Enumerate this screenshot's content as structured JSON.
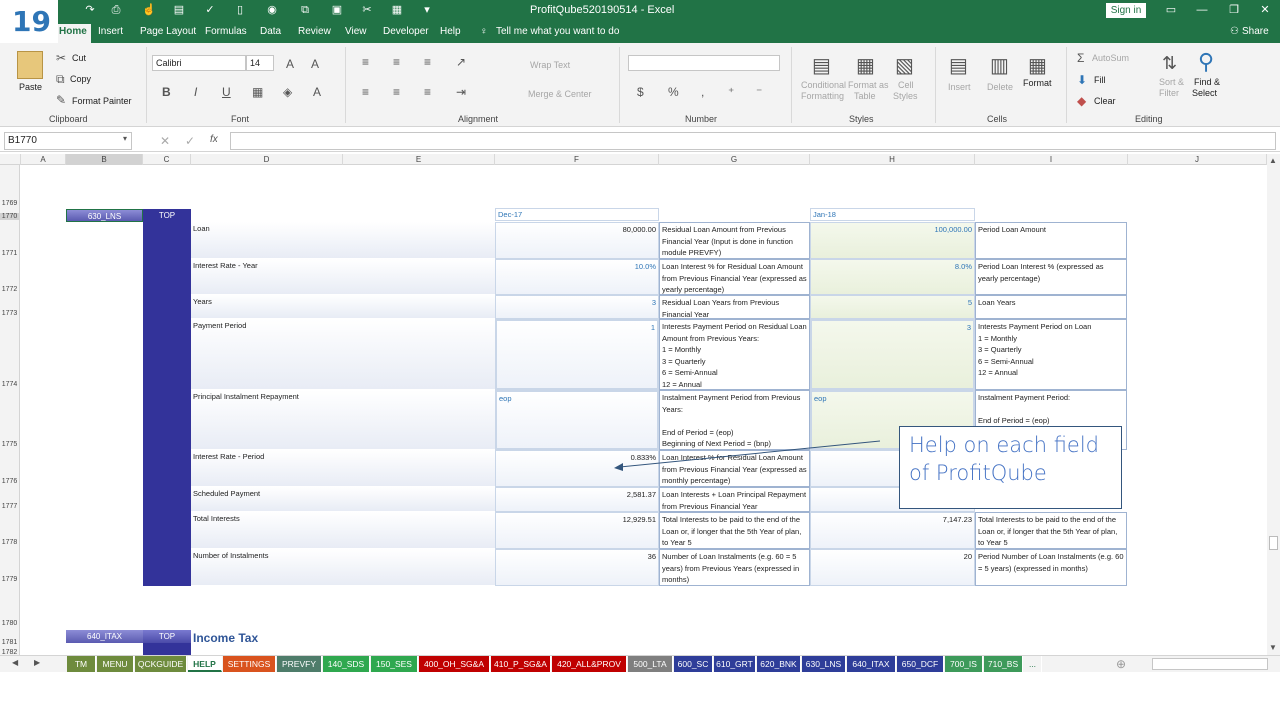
{
  "slide_number": "19",
  "window": {
    "title": "ProfitQube520190514  -  Excel",
    "sign_in": "Sign in",
    "share": "Share"
  },
  "tabs": [
    {
      "label": "Home",
      "active": true
    },
    {
      "label": "Insert"
    },
    {
      "label": "Page Layout"
    },
    {
      "label": "Formulas"
    },
    {
      "label": "Data"
    },
    {
      "label": "Review"
    },
    {
      "label": "View"
    },
    {
      "label": "Developer"
    },
    {
      "label": "Help"
    },
    {
      "label": "Tell me what you want to do"
    }
  ],
  "ribbon": {
    "paste": "Paste",
    "cut": "Cut",
    "copy": "Copy",
    "format_painter": "Format Painter",
    "clipboard": "Clipboard",
    "font_name": "Calibri",
    "font_size": "14",
    "font": "Font",
    "wrap_text": "Wrap Text",
    "merge_center": "Merge & Center",
    "alignment": "Alignment",
    "number": "Number",
    "conditional_formatting_1": "Conditional",
    "conditional_formatting_2": "Formatting",
    "format_as_table_1": "Format as",
    "format_as_table_2": "Table",
    "cell_styles_1": "Cell",
    "cell_styles_2": "Styles",
    "styles": "Styles",
    "insert": "Insert",
    "delete": "Delete",
    "format": "Format",
    "cells": "Cells",
    "autosum": "AutoSum",
    "fill": "Fill",
    "clear": "Clear",
    "sort_filter_1": "Sort &",
    "sort_filter_2": "Filter",
    "find_select_1": "Find &",
    "find_select_2": "Select",
    "editing": "Editing"
  },
  "formula_bar": {
    "name_box": "B1770",
    "formula": ""
  },
  "columns": [
    "A",
    "B",
    "C",
    "D",
    "E",
    "F",
    "G",
    "H",
    "I",
    "J"
  ],
  "rows": [
    "1769",
    "1770",
    "1771",
    "1772",
    "1773",
    "1774",
    "1775",
    "1776",
    "1777",
    "1778",
    "1779",
    "1780",
    "1781",
    "1782"
  ],
  "sheet": {
    "btn_lns": "630_LNS",
    "btn_top": "TOP",
    "btn_itax": "640_ITAX",
    "btn_top2": "TOP",
    "income_tax": "Income Tax",
    "period1": "Dec-17",
    "period2": "Jan-18",
    "items": [
      {
        "label": "Loan",
        "v1": "80,000.00",
        "d1": "Residual Loan Amount from Previous Financial Year (Input is done in function module PREVFY)",
        "v2": "100,000.00",
        "d2": "Period Loan Amount"
      },
      {
        "label": "Interest Rate - Year",
        "v1": "10.0%",
        "d1": "Loan Interest % for Residual Loan Amount from Previous Financial Year (expressed as yearly percentage)",
        "v2": "8.0%",
        "d2": "Period Loan Interest % (expressed as yearly percentage)"
      },
      {
        "label": "Years",
        "v1": "3",
        "d1": "Residual Loan Years  from Previous Financial Year",
        "v2": "5",
        "d2": "Loan Years"
      },
      {
        "label": "Payment Period",
        "v1": "1",
        "d1": "Interests Payment Period on Residual Loan Amount from Previous Years:\n1 = Monthly\n3 = Quarterly\n6 = Semi-Annual\n12 = Annual",
        "v2": "3",
        "d2": "Interests Payment Period on Loan\n1 = Monthly\n3 = Quarterly\n6 = Semi-Annual\n12 = Annual"
      },
      {
        "label": "Principal Instalment Repayment",
        "v1": "eop",
        "d1": "Instalment Payment Period from Previous Years:\n\nEnd of Period  = (eop)\nBeginning of Next Period  = (bnp)",
        "v2": "eop",
        "d2": "Instalment Payment Period:\n\nEnd of Period = (eop)"
      },
      {
        "label": "Interest Rate - Period",
        "v1": "0.833%",
        "d1": "Loan Interest % for Residual Loan Amount from Previous Financial Year (expressed as monthly percentage)",
        "v2": "",
        "d2": ""
      },
      {
        "label": "Scheduled Payment",
        "v1": "2,581.37",
        "d1": "Loan Interests + Loan Principal Repayment from Previous Financial Year",
        "v2": "",
        "d2": ""
      },
      {
        "label": "Total Interests",
        "v1": "12,929.51",
        "d1": "Total Interests to be paid to the end of the Loan or, if longer that the 5th Year of plan, to Year 5",
        "v2": "7,147.23",
        "d2": "Total Interests to be paid to the end of the Loan or, if longer that the 5th Year of plan, to Year 5"
      },
      {
        "label": "Number of Instalments",
        "v1": "36",
        "d1": "Number of Loan Instalments (e.g. 60 = 5 years) from Previous Years (expressed in months)",
        "v2": "20",
        "d2": "Period Number of Loan Instalments (e.g. 60 = 5 years) (expressed in months)"
      }
    ]
  },
  "callout": {
    "line1": "Help on each field",
    "line2": "of ProfitQube"
  },
  "sheet_tabs": [
    {
      "label": "TM",
      "color": "#6e8b3d"
    },
    {
      "label": "MENU",
      "color": "#6e8b3d"
    },
    {
      "label": "QCKGUIDE",
      "color": "#6e8b3d"
    },
    {
      "label": "HELP",
      "color": "#ffffff",
      "active": true
    },
    {
      "label": "SETTINGS",
      "color": "#d9531e"
    },
    {
      "label": "PREVFY",
      "color": "#4e7c6a"
    },
    {
      "label": "140_SDS",
      "color": "#2fa84f"
    },
    {
      "label": "150_SES",
      "color": "#2fa84f"
    },
    {
      "label": "400_OH_SG&A",
      "color": "#c00000"
    },
    {
      "label": "410_P_SG&A",
      "color": "#c00000"
    },
    {
      "label": "420_ALL&PROV",
      "color": "#c00000"
    },
    {
      "label": "500_LTA",
      "color": "#7f7f7f"
    },
    {
      "label": "600_SC",
      "color": "#2e3d99"
    },
    {
      "label": "610_GRT",
      "color": "#2e3d99"
    },
    {
      "label": "620_BNK",
      "color": "#2e3d99"
    },
    {
      "label": "630_LNS",
      "color": "#2e3d99"
    },
    {
      "label": "640_ITAX",
      "color": "#2e3d99"
    },
    {
      "label": "650_DCF",
      "color": "#2e3d99"
    },
    {
      "label": "700_IS",
      "color": "#3d9a5a"
    },
    {
      "label": "710_BS",
      "color": "#3d9a5a"
    },
    {
      "label": "...",
      "color": "#f3f3f3"
    }
  ]
}
